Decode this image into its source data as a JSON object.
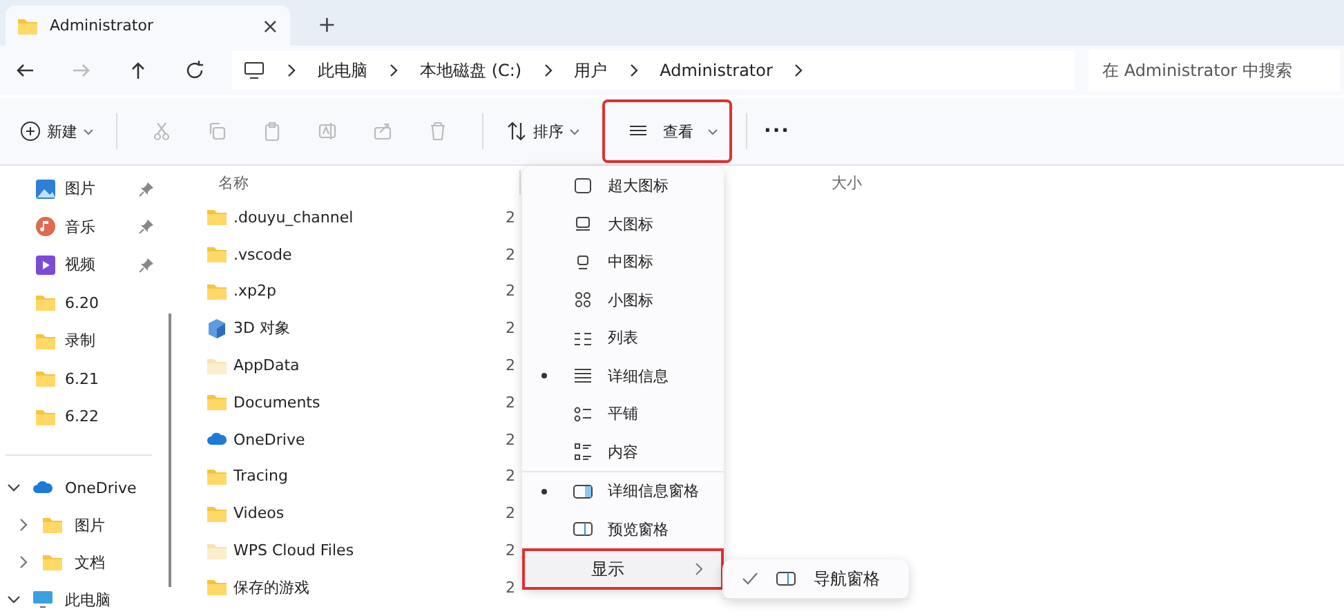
{
  "tab": {
    "title": "Administrator",
    "close": "×",
    "new_tab": "+"
  },
  "address": {
    "crumbs": [
      "此电脑",
      "本地磁盘 (C:)",
      "用户",
      "Administrator"
    ],
    "search_placeholder": "在 Administrator 中搜索"
  },
  "toolbar": {
    "new_label": "新建",
    "sort_label": "排序",
    "view_label": "查看",
    "view_highlighted": true,
    "more": "···"
  },
  "sidebar": {
    "quick": [
      {
        "label": "图片",
        "kind": "pictures",
        "pinned": true
      },
      {
        "label": "音乐",
        "kind": "music",
        "pinned": true
      },
      {
        "label": "视频",
        "kind": "videos",
        "pinned": true
      },
      {
        "label": "6.20",
        "kind": "folder",
        "pinned": false
      },
      {
        "label": "录制",
        "kind": "folder",
        "pinned": false
      },
      {
        "label": "6.21",
        "kind": "folder",
        "pinned": false
      },
      {
        "label": "6.22",
        "kind": "folder",
        "pinned": false
      }
    ],
    "tree": [
      {
        "label": "OneDrive",
        "kind": "cloud",
        "expanded": true,
        "children": [
          {
            "label": "图片",
            "kind": "folder",
            "expanded": false
          },
          {
            "label": "文档",
            "kind": "folder",
            "expanded": false
          }
        ]
      },
      {
        "label": "此电脑",
        "kind": "pc",
        "expanded": true
      }
    ]
  },
  "table": {
    "columns": [
      "名称",
      "大小"
    ],
    "rows": [
      {
        "name": ".douyu_channel",
        "kind": "folder",
        "date": "2"
      },
      {
        "name": ".vscode",
        "kind": "folder",
        "date": "2"
      },
      {
        "name": ".xp2p",
        "kind": "folder",
        "date": "2"
      },
      {
        "name": "3D 对象",
        "kind": "cube",
        "date": "2"
      },
      {
        "name": "AppData",
        "kind": "hidden-folder",
        "date": "2"
      },
      {
        "name": "Documents",
        "kind": "folder",
        "date": "2"
      },
      {
        "name": "OneDrive",
        "kind": "cloud",
        "date": "2"
      },
      {
        "name": "Tracing",
        "kind": "folder",
        "date": "2"
      },
      {
        "name": "Videos",
        "kind": "folder",
        "date": "2"
      },
      {
        "name": "WPS Cloud Files",
        "kind": "hidden-folder",
        "date": "2"
      },
      {
        "name": "保存的游戏",
        "kind": "folder",
        "date": "2"
      }
    ]
  },
  "view_menu": {
    "items": [
      {
        "label": "超大图标",
        "kind": "xl",
        "selected": false
      },
      {
        "label": "大图标",
        "kind": "large",
        "selected": false
      },
      {
        "label": "中图标",
        "kind": "medium",
        "selected": false
      },
      {
        "label": "小图标",
        "kind": "small",
        "selected": false
      },
      {
        "label": "列表",
        "kind": "list",
        "selected": false
      },
      {
        "label": "详细信息",
        "kind": "details",
        "selected": true
      },
      {
        "label": "平铺",
        "kind": "tiles",
        "selected": false
      },
      {
        "label": "内容",
        "kind": "content",
        "selected": false
      },
      {
        "label": "详细信息窗格",
        "kind": "details-pane",
        "selected": true
      },
      {
        "label": "预览窗格",
        "kind": "preview-pane",
        "selected": false
      },
      {
        "label": "显示",
        "kind": "submenu",
        "highlighted": true
      }
    ]
  },
  "show_menu": {
    "items": [
      {
        "label": "导航窗格",
        "checked": true
      }
    ]
  }
}
